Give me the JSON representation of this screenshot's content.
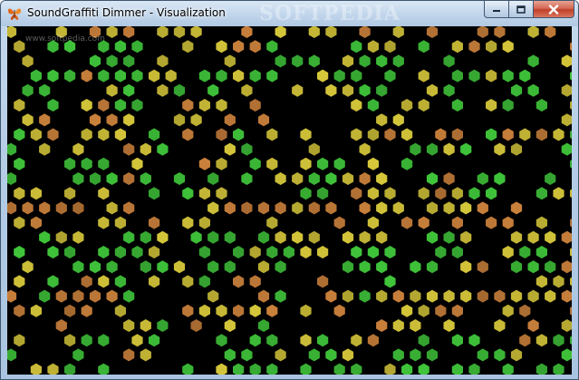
{
  "window": {
    "title": "SoundGraffiti Dimmer - Visualization"
  },
  "watermark": {
    "logo_text": "SOFTPEDIA",
    "url_text": "www.softpedia.com"
  },
  "colors": {
    "background": "#000000",
    "hex_orange": "#c9803b",
    "hex_yellow": "#d6c73a",
    "hex_green": "#3fc43a"
  },
  "icons": {
    "app": "butterfly-icon",
    "minimize": "minimize-icon",
    "maximize": "maximize-icon",
    "close": "close-icon"
  }
}
